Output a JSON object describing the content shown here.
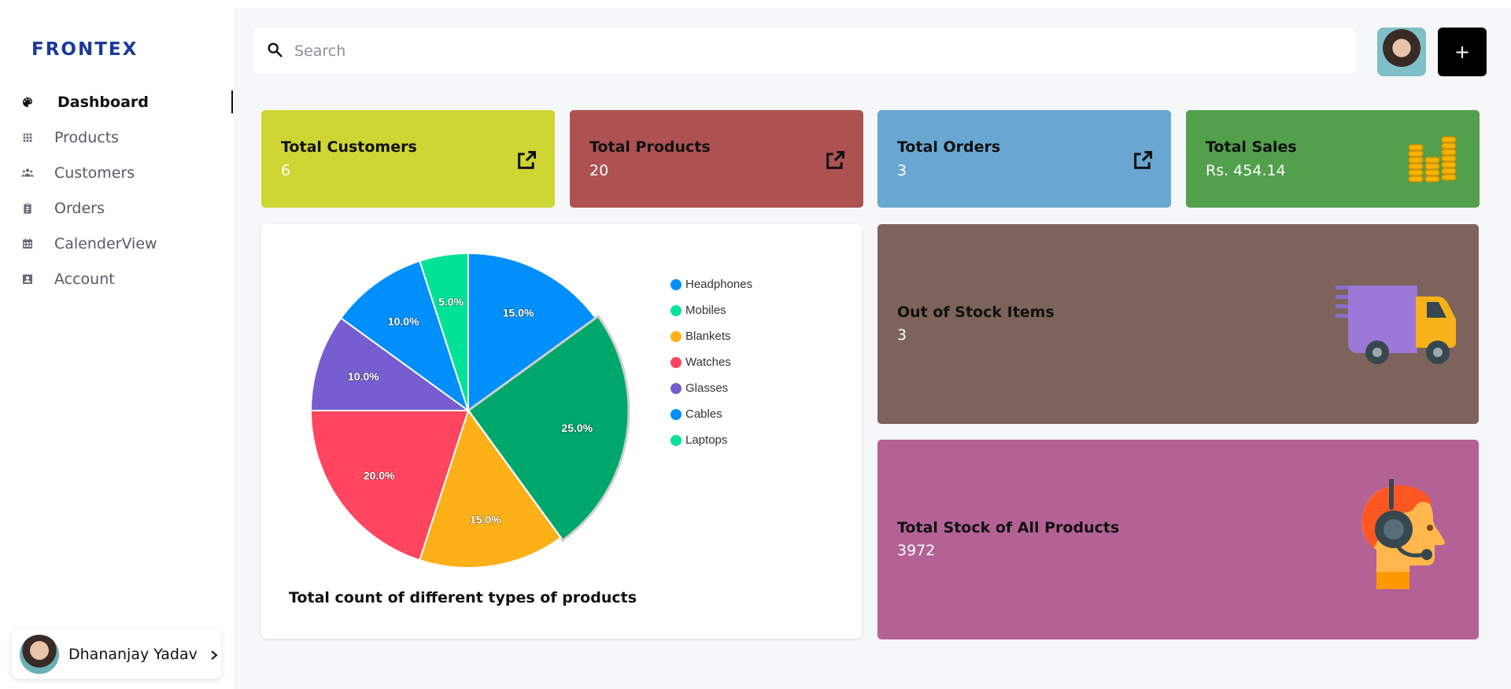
{
  "brand": {
    "logo_text": "FRONTEX",
    "logo_color": "#1a3a9c"
  },
  "sidebar": {
    "items": [
      {
        "label": "Dashboard",
        "icon": "palette-icon",
        "active": true
      },
      {
        "label": "Products",
        "icon": "grid-icon"
      },
      {
        "label": "Customers",
        "icon": "people-icon"
      },
      {
        "label": "Orders",
        "icon": "clipboard-icon"
      },
      {
        "label": "CalenderView",
        "icon": "calendar-icon"
      },
      {
        "label": "Account",
        "icon": "account-box-icon"
      }
    ],
    "user": {
      "name": "Dhananjay Yadav"
    }
  },
  "header": {
    "search_placeholder": "Search",
    "add_button_label": "+"
  },
  "stats": [
    {
      "title": "Total Customers",
      "value": "6",
      "color": "#cdd633",
      "icon": "external-link-icon"
    },
    {
      "title": "Total Products",
      "value": "20",
      "color": "#ad5152",
      "icon": "external-link-icon"
    },
    {
      "title": "Total Orders",
      "value": "3",
      "color": "#69a6d1",
      "icon": "external-link-icon"
    },
    {
      "title": "Total Sales",
      "value": "Rs. 454.14",
      "color": "#52a04c",
      "icon": "coins-icon"
    }
  ],
  "chart_data": {
    "type": "pie",
    "title": "Total count of different types of products",
    "legend_position": "right",
    "slices": [
      {
        "label": "Headphones",
        "value": 15.0,
        "color": "#008ffb"
      },
      {
        "label": "Mobiles",
        "value": 25.0,
        "color": "#00a76a"
      },
      {
        "label": "Blankets",
        "value": 15.0,
        "color": "#feb019"
      },
      {
        "label": "Watches",
        "value": 20.0,
        "color": "#ff4560"
      },
      {
        "label": "Glasses",
        "value": 10.0,
        "color": "#775dd0"
      },
      {
        "label": "Cables",
        "value": 10.0,
        "color": "#008ffb"
      },
      {
        "label": "Laptops",
        "value": 5.0,
        "color": "#00e396"
      }
    ],
    "legend": [
      {
        "label": "Headphones",
        "color": "#008ffb"
      },
      {
        "label": "Mobiles",
        "color": "#00e396"
      },
      {
        "label": "Blankets",
        "color": "#feb019"
      },
      {
        "label": "Watches",
        "color": "#ff4560"
      },
      {
        "label": "Glasses",
        "color": "#775dd0"
      },
      {
        "label": "Cables",
        "color": "#008ffb"
      },
      {
        "label": "Laptops",
        "color": "#00e396"
      }
    ]
  },
  "panels": [
    {
      "title": "Out of Stock Items",
      "value": "3",
      "color": "#7d635c",
      "icon": "delivery-truck-icon"
    },
    {
      "title": "Total Stock of All Products",
      "value": "3972",
      "color": "#b46296",
      "icon": "customer-support-icon"
    }
  ]
}
